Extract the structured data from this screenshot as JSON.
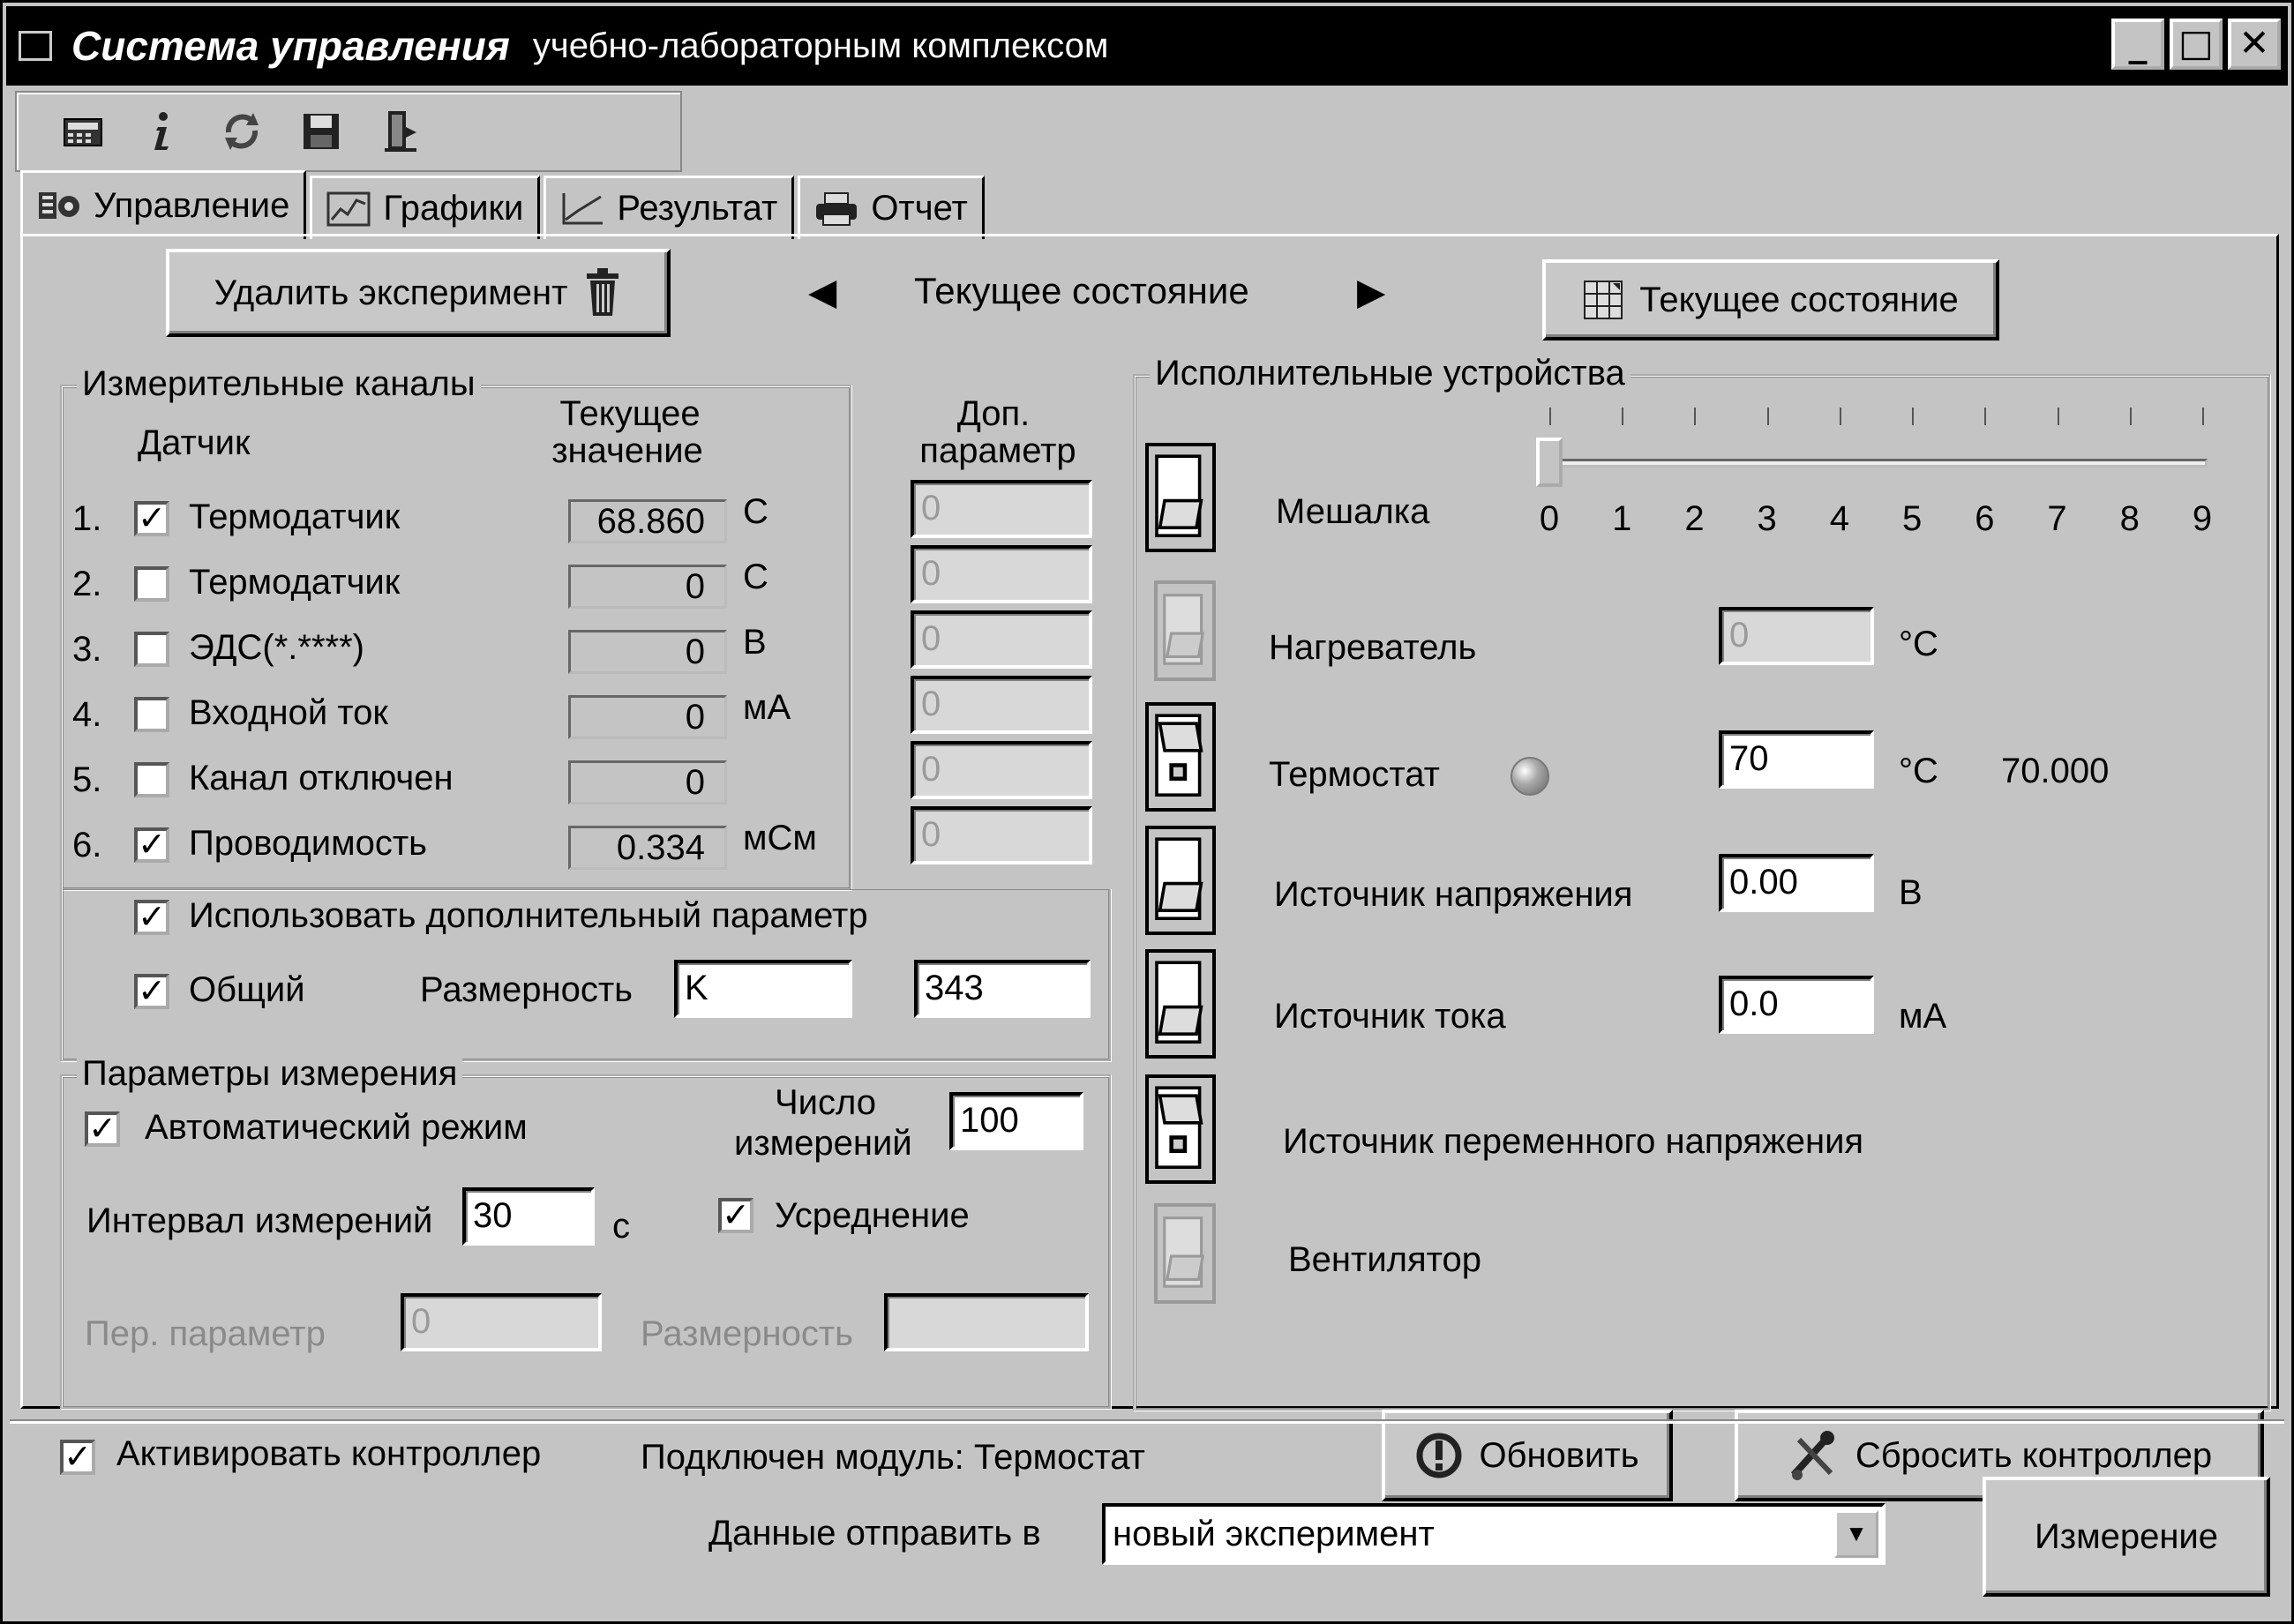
{
  "window": {
    "title_bold": "Система управления",
    "title_rest": "учебно-лабораторным комплексом",
    "btn_minimize": "_",
    "btn_maximize": "□",
    "btn_close": "✕"
  },
  "toolbar": {
    "icons": [
      "calculator-icon",
      "info-icon",
      "refresh-icon",
      "save-icon",
      "exit-icon"
    ]
  },
  "tabs": [
    {
      "label": "Управление",
      "icon": "control-icon",
      "active": true
    },
    {
      "label": "Графики",
      "icon": "graphs-icon",
      "active": false
    },
    {
      "label": "Результат",
      "icon": "result-icon",
      "active": false
    },
    {
      "label": "Отчет",
      "icon": "printer-icon",
      "active": false
    }
  ],
  "top": {
    "delete_button": "Удалить эксперимент",
    "nav_prev": "◀",
    "nav_label": "Текущее состояние",
    "nav_next": "▶",
    "state_button": "Текущее состояние"
  },
  "channels": {
    "title": "Измерительные каналы",
    "col_sensor": "Датчик",
    "col_current_1": "Текущее",
    "col_current_2": "значение",
    "col_extra_1": "Доп.",
    "col_extra_2": "параметр",
    "rows": [
      {
        "num": "1.",
        "checked": true,
        "name": "Термодатчик",
        "value": "68.860",
        "unit": "C",
        "extra": "0"
      },
      {
        "num": "2.",
        "checked": false,
        "name": "Термодатчик",
        "value": "0",
        "unit": "C",
        "extra": "0"
      },
      {
        "num": "3.",
        "checked": false,
        "name": "ЭДС(*.****)",
        "value": "0",
        "unit": "В",
        "extra": "0"
      },
      {
        "num": "4.",
        "checked": false,
        "name": "Входной ток",
        "value": "0",
        "unit": "мА",
        "extra": "0"
      },
      {
        "num": "5.",
        "checked": false,
        "name": "Канал отключен",
        "value": "0",
        "unit": "",
        "extra": "0"
      },
      {
        "num": "6.",
        "checked": true,
        "name": "Проводимость",
        "value": "0.334",
        "unit": "мСм",
        "extra": "0"
      }
    ],
    "use_extra_label": "Использовать дополнительный параметр",
    "common_label": "Общий",
    "dimension_label": "Размерность",
    "dimension_value": "K",
    "common_value": "343"
  },
  "measure": {
    "title": "Параметры измерения",
    "auto_label": "Автоматический режим",
    "count_label_1": "Число",
    "count_label_2": "измерений",
    "count_value": "100",
    "interval_label": "Интервал измерений",
    "interval_value": "30",
    "interval_unit": "с",
    "avg_label": "Усреднение",
    "var_param_label": "Пер. параметр",
    "var_param_value": "0",
    "var_dim_label": "Размерность",
    "var_dim_value": ""
  },
  "devices": {
    "title": "Исполнительные устройства",
    "stirrer_label": "Мешалка",
    "stirrer_level": 0,
    "stirrer_ticks": [
      "0",
      "1",
      "2",
      "3",
      "4",
      "5",
      "6",
      "7",
      "8",
      "9"
    ],
    "heater_label": "Нагреватель",
    "heater_value": "0",
    "heater_unit": "°C",
    "thermostat_label": "Термостат",
    "thermostat_value": "70",
    "thermostat_unit": "°C",
    "thermostat_reading": "70.000",
    "voltage_label": "Источник напряжения",
    "voltage_value": "0.00",
    "voltage_unit": "В",
    "current_label": "Источник тока",
    "current_value": "0.0",
    "current_unit": "мА",
    "ac_label": "Источник переменного напряжения",
    "fan_label": "Вентилятор"
  },
  "bottom": {
    "activate_label": "Активировать контроллер",
    "module_label": "Подключен модуль: Термостат",
    "refresh_button": "Обновить",
    "reset_button": "Сбросить контроллер"
  },
  "status": {
    "send_label": "Данные отправить в",
    "send_value": "новый эксперимент",
    "measure_button": "Измерение"
  }
}
